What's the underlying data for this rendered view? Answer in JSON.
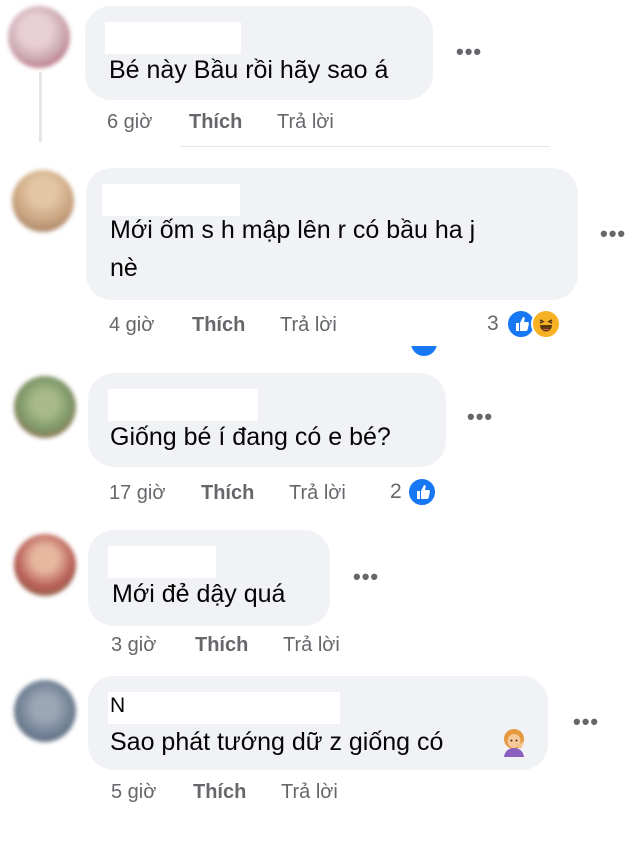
{
  "comments": [
    {
      "text_lines": [
        "Bé này Bầu rồi hãy sao á"
      ],
      "time": "6 giờ",
      "like": "Thích",
      "reply": "Trả lời",
      "reaction_count": "",
      "avatar_color": "#c9a3ad"
    },
    {
      "text_lines": [
        "Mới ốm s h mập lên r có bầu ha j",
        "nè"
      ],
      "time": "4 giờ",
      "like": "Thích",
      "reply": "Trả lời",
      "reaction_count": "3",
      "avatar_color": "#c8a27f"
    },
    {
      "text_lines": [
        "Giống bé í đang có e bé?"
      ],
      "time": "17 giờ",
      "like": "Thích",
      "reply": "Trả lời",
      "reaction_count": "2",
      "avatar_color": "#7e9a6a"
    },
    {
      "text_lines": [
        "Mới đẻ dậy quá"
      ],
      "time": "3 giờ",
      "like": "Thích",
      "reply": "Trả lời",
      "reaction_count": "",
      "avatar_color": "#b65b55"
    },
    {
      "text_lines": [
        "Sao phát tướng dữ z giống có"
      ],
      "name_initial": "N",
      "time": "5 giờ",
      "like": "Thích",
      "reply": "Trả lời",
      "reaction_count": "",
      "avatar_color": "#6f7f93"
    }
  ],
  "more_glyph": "•••",
  "icons": {
    "like": "like-icon",
    "haha": "haha-icon",
    "emoji": "woman-emoji-icon"
  },
  "colors": {
    "bubble": "#f0f2f5",
    "meta": "#65676b",
    "like_blue": "#1877f2",
    "haha_yellow": "#f7b125"
  }
}
